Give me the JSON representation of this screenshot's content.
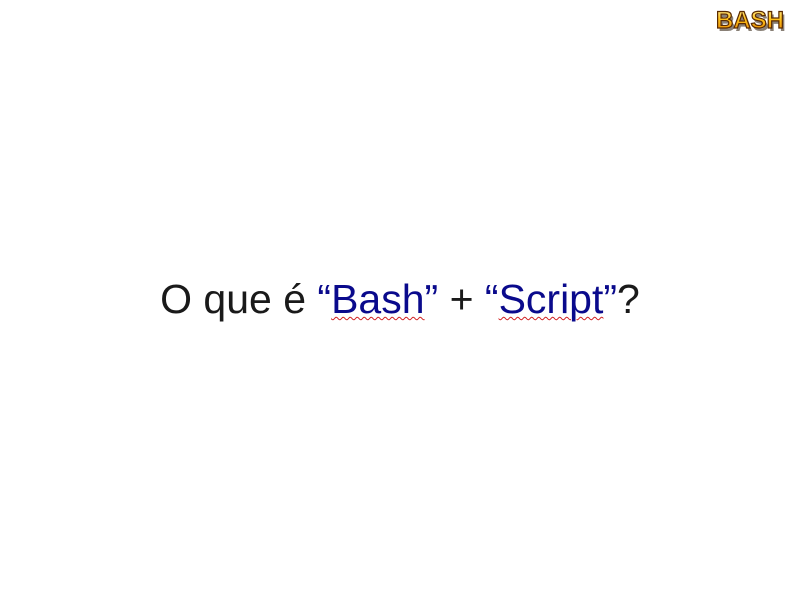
{
  "logo": {
    "text": "BASH",
    "colors": {
      "fill_top": "#ffe680",
      "fill_bottom": "#e88a00",
      "stroke": "#5a2a00",
      "shadow": "#3a2a10"
    }
  },
  "title": {
    "prefix": "O que é ",
    "open_quote_1": "“",
    "word_1": "Bash",
    "close_quote_1": "”",
    "plus": " + ",
    "open_quote_2": "“",
    "word_2": "Script",
    "close_quote_2": "”",
    "suffix": "?"
  },
  "colors": {
    "background": "#ffffff",
    "text": "#1a1a1a",
    "accent": "#0a0a8c",
    "spellcheck": "#d02020"
  }
}
